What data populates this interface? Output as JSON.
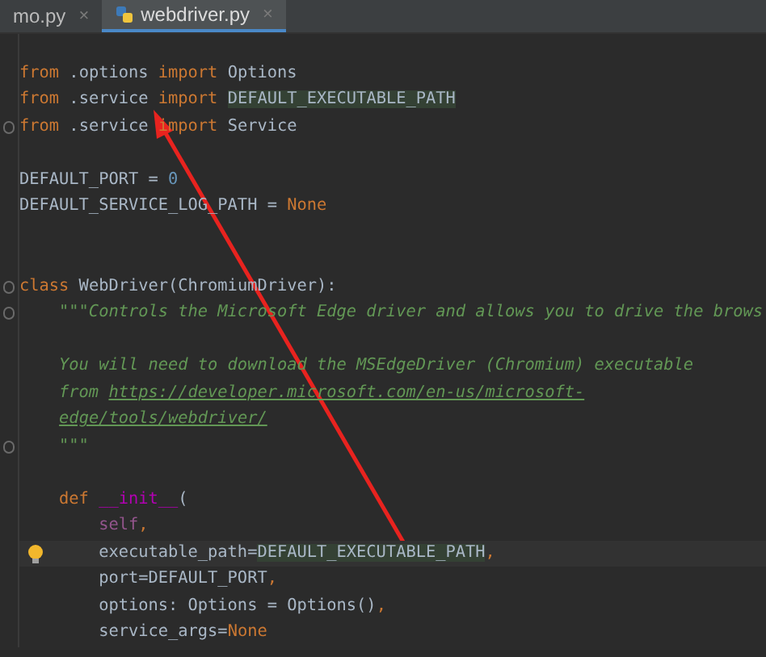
{
  "tabs": [
    {
      "label": "mo.py",
      "close": "×",
      "selected": false,
      "icon": false
    },
    {
      "label": "webdriver.py",
      "close": "×",
      "selected": true,
      "icon": true
    }
  ],
  "lines": [
    {
      "kind": "blank"
    },
    {
      "kind": "code",
      "tokens": [
        {
          "text": "from",
          "kind": "keyword"
        },
        {
          "text": " .options ",
          "kind": "plain"
        },
        {
          "text": "import",
          "kind": "keyword"
        },
        {
          "text": " Options",
          "kind": "plain"
        }
      ]
    },
    {
      "kind": "code",
      "tokens": [
        {
          "text": "from",
          "kind": "keyword"
        },
        {
          "text": " .service ",
          "kind": "plain"
        },
        {
          "text": "import ",
          "kind": "keyword"
        },
        {
          "text": "DEFAULT_EXECUTABLE_PATH",
          "kind": "match"
        }
      ]
    },
    {
      "kind": "code",
      "fold": true,
      "tokens": [
        {
          "text": "from",
          "kind": "keyword"
        },
        {
          "text": " .service ",
          "kind": "plain"
        },
        {
          "text": "import",
          "kind": "keyword"
        },
        {
          "text": " Service",
          "kind": "plain"
        }
      ]
    },
    {
      "kind": "blank"
    },
    {
      "kind": "code",
      "tokens": [
        {
          "text": "DEFAULT_PORT = ",
          "kind": "plain"
        },
        {
          "text": "0",
          "kind": "number"
        }
      ]
    },
    {
      "kind": "code",
      "tokens": [
        {
          "text": "DEFAULT_SERVICE_LOG_PATH = ",
          "kind": "plain"
        },
        {
          "text": "None",
          "kind": "keyword"
        }
      ]
    },
    {
      "kind": "blank"
    },
    {
      "kind": "blank"
    },
    {
      "kind": "code",
      "fold": true,
      "tokens": [
        {
          "text": "class",
          "kind": "keyword"
        },
        {
          "text": " WebDriver(ChromiumDriver):",
          "kind": "plain"
        }
      ]
    },
    {
      "kind": "code",
      "fold": true,
      "tokens": [
        {
          "text": "    \"\"\"Controls the Microsoft Edge driver and allows you to drive the brows",
          "kind": "doc"
        }
      ]
    },
    {
      "kind": "blank"
    },
    {
      "kind": "code",
      "tokens": [
        {
          "text": "    You will need to download the MSEdgeDriver (Chromium) executable",
          "kind": "doc"
        }
      ]
    },
    {
      "kind": "code",
      "tokens": [
        {
          "text": "    from ",
          "kind": "doc"
        },
        {
          "text": "https://developer.microsoft.com/en-us/microsoft-",
          "kind": "link"
        }
      ]
    },
    {
      "kind": "code",
      "tokens": [
        {
          "text": "    edge/tools/webdriver/",
          "kind": "link"
        }
      ]
    },
    {
      "kind": "code",
      "fold": true,
      "tokens": [
        {
          "text": "    \"\"\"",
          "kind": "doc"
        }
      ]
    },
    {
      "kind": "blank"
    },
    {
      "kind": "code",
      "tokens": [
        {
          "text": "    def ",
          "kind": "keyword"
        },
        {
          "text": "__init__",
          "kind": "magic"
        },
        {
          "text": "(",
          "kind": "plain"
        }
      ]
    },
    {
      "kind": "code",
      "tokens": [
        {
          "text": "        self",
          "kind": "self"
        },
        {
          "text": ",",
          "kind": "keyword"
        }
      ]
    },
    {
      "kind": "code",
      "current": true,
      "bulb": true,
      "tokens": [
        {
          "text": "        executable_path=",
          "kind": "plain"
        },
        {
          "text": "DEFAULT_EXECUTABLE_PATH",
          "kind": "match"
        },
        {
          "text": ",",
          "kind": "keyword"
        }
      ]
    },
    {
      "kind": "code",
      "tokens": [
        {
          "text": "        port=DEFAULT_PORT",
          "kind": "plain"
        },
        {
          "text": ",",
          "kind": "keyword"
        }
      ]
    },
    {
      "kind": "code",
      "tokens": [
        {
          "text": "        options: Options = Options()",
          "kind": "plain"
        },
        {
          "text": ",",
          "kind": "keyword"
        }
      ]
    },
    {
      "kind": "code",
      "tokens": [
        {
          "text": "        service_args=",
          "kind": "plain"
        },
        {
          "text": "None",
          "kind": "keyword"
        }
      ]
    }
  ]
}
